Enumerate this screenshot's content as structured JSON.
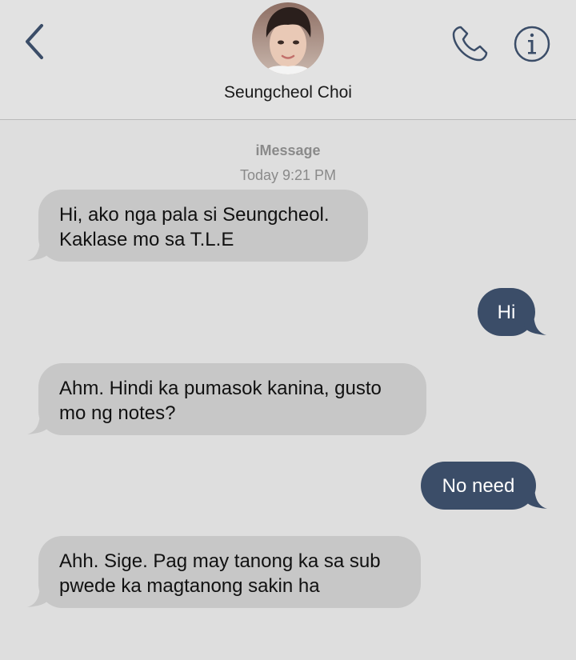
{
  "header": {
    "back_icon": "chevron-left-icon",
    "contact_name": "Seungcheol Choi",
    "phone_icon": "phone-icon",
    "info_icon": "info-icon"
  },
  "thread": {
    "service": "iMessage",
    "timestamp": "Today 9:21 PM"
  },
  "messages": [
    {
      "direction": "incoming",
      "text": "Hi, ako nga pala si Seungcheol.\nKaklase mo sa T.L.E"
    },
    {
      "direction": "outgoing",
      "text": "Hi"
    },
    {
      "direction": "incoming",
      "text": "Ahm. Hindi ka pumasok kanina, gusto\nmo ng notes?"
    },
    {
      "direction": "outgoing",
      "text": "No need"
    },
    {
      "direction": "incoming",
      "text": "Ahh. Sige. Pag may tanong ka sa sub\npwede ka magtanong sakin ha"
    }
  ],
  "colors": {
    "background": "#dedede",
    "incoming_bubble": "#c7c7c7",
    "outgoing_bubble": "#3b4d68",
    "accent": "#3b4d68",
    "meta_text": "#8a8a8a"
  }
}
